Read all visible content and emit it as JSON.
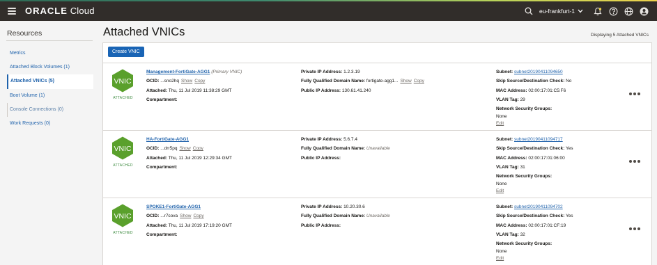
{
  "topbar": {
    "brand_bold": "ORACLE",
    "brand_light": "Cloud",
    "region": "eu-frankfurt-1",
    "icons": [
      "menu-icon",
      "search-icon",
      "chevron-down-icon",
      "bell-icon",
      "help-icon",
      "globe-icon",
      "user-icon"
    ]
  },
  "sidebar": {
    "title": "Resources",
    "items": [
      {
        "label": "Metrics"
      },
      {
        "label": "Attached Block Volumes (1)"
      },
      {
        "label": "Attached VNICs (5)"
      },
      {
        "label": "Boot Volume (1)"
      },
      {
        "label": "Console Connections (0)"
      },
      {
        "label": "Work Requests (0)"
      }
    ]
  },
  "main": {
    "title": "Attached VNICs",
    "count_text": "Displaying 5 Attached VNICs",
    "create_label": "Create VNIC"
  },
  "labels": {
    "ocid": "OCID:",
    "attached": "Attached:",
    "compartment": "Compartment:",
    "private_ip": "Private IP Address:",
    "fqdn": "Fully Qualified Domain Name:",
    "public_ip": "Public IP Address:",
    "subnet": "Subnet:",
    "skip_check": "Skip Source/Destination Check:",
    "mac": "MAC Address:",
    "vlan": "VLAN Tag:",
    "nsg": "Network Security Groups:",
    "show": "Show",
    "copy": "Copy",
    "edit": "Edit",
    "badge": "VNIC",
    "status": "ATTACHED"
  },
  "vnics": [
    {
      "name": "Management-FortiGate-AGG1",
      "primary": "(Primary VNIC)",
      "ocid": "...sno2hq",
      "attached": "Thu, 11 Jul 2019 11:38:29 GMT",
      "compartment": "",
      "private_ip": "1.2.3.19",
      "fqdn": "fortigate-agg1...",
      "public_ip": "130.61.41.240",
      "subnet": "subnet20190411094650",
      "skip_check": "No",
      "mac": "02:00:17:01:C5:F6",
      "vlan": "29",
      "nsg": "None"
    },
    {
      "name": "HA-FortiGate-AGG1",
      "primary": "",
      "ocid": "...drr5pq",
      "attached": "Thu, 11 Jul 2019 12:29:34 GMT",
      "compartment": "",
      "private_ip": "5.6.7.4",
      "fqdn": "Unavailable",
      "public_ip": "",
      "subnet": "subnet20190411094717",
      "skip_check": "Yes",
      "mac": "02:00:17:01:06:00",
      "vlan": "31",
      "nsg": "None"
    },
    {
      "name": "SPOKE1-FortiGate-AGG1",
      "primary": "",
      "ocid": "...r7cova",
      "attached": "Thu, 11 Jul 2019 17:19:20 GMT",
      "compartment": "",
      "private_ip": "10.20.30.6",
      "fqdn": "Unavailable",
      "public_ip": "",
      "subnet": "subnet20190411094702",
      "skip_check": "Yes",
      "mac": "02:00:17:01:CF:19",
      "vlan": "32",
      "nsg": "None"
    }
  ],
  "colors": {
    "topbar_bg": "#312d2a",
    "accent_blue": "#1964b5",
    "link_blue": "#1f62ab",
    "vnic_green": "#5aa02c",
    "status_green": "#3c8a3f"
  }
}
